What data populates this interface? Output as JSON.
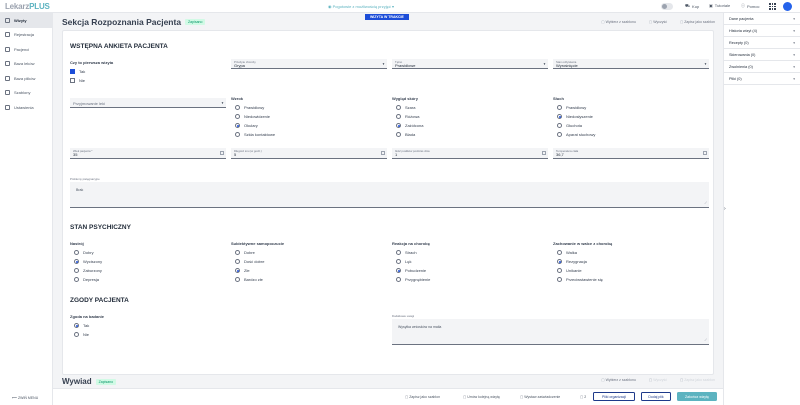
{
  "topbar": {
    "logo_main": "Lekarz",
    "logo_accent": "PLUS",
    "facility": "Pogotowie z możliwością przyjęć",
    "help": "Kup",
    "tutorials": "Tutoriale",
    "notifications": "Pomoc"
  },
  "sidebar": {
    "items": [
      {
        "label": "Wizyty"
      },
      {
        "label": "Rejestracja"
      },
      {
        "label": "Pacjenci"
      },
      {
        "label": "Baza leków"
      },
      {
        "label": "Baza plików"
      },
      {
        "label": "Szablony"
      },
      {
        "label": "Ustawienia"
      }
    ],
    "collapse": "ZWIŃ MENU"
  },
  "header": {
    "title": "Sekcja Rozpoznania Pacjenta",
    "badge": "Zapisano",
    "visit_tag": "WIZYTA W TRAKCIE",
    "actions": [
      "Wybierz z szablonu",
      "Wyczyść",
      "Zapisz jako szablon"
    ]
  },
  "survey": {
    "title": "WSTĘPNA ANKIETA PACJENTA",
    "first_visit": {
      "label": "Czy to pierwsza wizyta",
      "options": [
        "Tak",
        "Nie"
      ],
      "selected": "Tak"
    },
    "disease": {
      "label": "Przebyte choroby",
      "value": "Grypa"
    },
    "weight_type": {
      "label": "Tętno",
      "value": "Prawidłowe"
    },
    "immunization": {
      "label": "Stan odżywienia",
      "value": "Wyrośnięcie"
    },
    "admitted_from": {
      "placeholder": "Przyjmowanie leki"
    },
    "vision": {
      "label": "Wzrok",
      "options": [
        "Prawidłowy",
        "Niedowidzenie",
        "Okulary",
        "Szkła kontaktowe"
      ],
      "selected": "Okulary"
    },
    "skin": {
      "label": "Wygląd skóry",
      "options": [
        "Szara",
        "Różowa",
        "Zażółcona",
        "Blada"
      ],
      "selected": "Zażółcona"
    },
    "hearing": {
      "label": "Słuch",
      "options": [
        "Prawidłowy",
        "Niedosłyszenie",
        "Głuchota",
        "Aparat słuchowy"
      ],
      "selected": "Niedosłyszenie"
    },
    "age": {
      "label": "Wiek pacjenta *",
      "value": "35"
    },
    "sleep": {
      "label": "Długość snu (w godz.)",
      "value": "5"
    },
    "meals": {
      "label": "Ilość posiłków podczas dnia",
      "value": "1"
    },
    "temperature": {
      "label": "Temperatura ciała",
      "value": "36,7"
    },
    "notes": {
      "label": "Problemy pielęgnacyjne",
      "value": "Brak"
    }
  },
  "psych": {
    "title": "STAN PSYCHICZNY",
    "mood": {
      "label": "Nastrój",
      "options": [
        "Dobry",
        "Wyciszony",
        "Zaburzony",
        "Depresja"
      ],
      "selected": "Wyciszony"
    },
    "wellbeing": {
      "label": "Subiektywne samopoczucie",
      "options": [
        "Dobre",
        "Dość dobre",
        "Złe",
        "Bardzo złe"
      ],
      "selected": "Złe"
    },
    "reaction": {
      "label": "Reakcja na chorobę",
      "options": [
        "Strach",
        "Lęk",
        "Pobudzenie",
        "Przygnębienie"
      ],
      "selected": "Pobudzenie"
    },
    "behavior": {
      "label": "Zachowanie w walce z chorobą",
      "options": [
        "Walka",
        "Rezygnacja",
        "Unikanie",
        "Przeciwstawienie się"
      ],
      "selected": "Rezygnacja"
    }
  },
  "consent": {
    "title": "ZGODY PACJENTA",
    "exam": {
      "label": "Zgoda na badanie",
      "options": [
        "Tak",
        "Nie"
      ],
      "selected": "Tak"
    },
    "remarks": {
      "label": "Dodatkowe uwagi",
      "value": "Wysyłka wniosków na maila"
    }
  },
  "interview": {
    "title": "Wywiad",
    "badge": "Zapisano",
    "actions": [
      "Wybierz z szablonu",
      "Wyczyść",
      "Zapisz jako szablon"
    ]
  },
  "bottombar": {
    "save_template": "Zapisz jako szablon",
    "next_visit": "Umów kolejną wizytę",
    "print": "Wystaw zaświadczenie",
    "count": "2",
    "files_btn": "Pliki organizacji",
    "add_file_btn": "Dodaj plik",
    "finish_btn": "Zakończ wizytę"
  },
  "rightpanel": {
    "items": [
      "Dane pacjenta",
      "Historia wizyt (4)",
      "Recepty (0)",
      "Skierowania (0)",
      "Zwolnienia (0)",
      "Pliki (0)"
    ]
  },
  "colors": {
    "accent": "#5cb3c0",
    "primary": "#1d4ed8",
    "navy": "#1e3a8a"
  }
}
